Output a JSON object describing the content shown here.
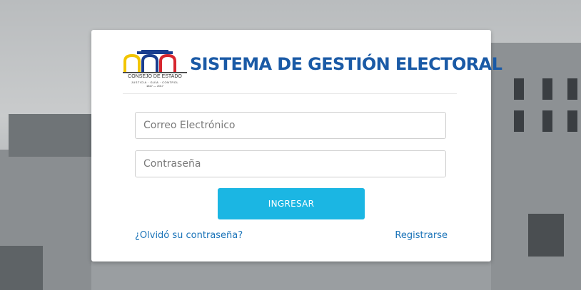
{
  "logo": {
    "name": "CONSEJO DE ESTADO",
    "motto": "JUSTICIA · GUÍA · CONTROL",
    "years": "1817 — 2017"
  },
  "title": "SISTEMA DE GESTIÓN ELECTORAL",
  "form": {
    "email_placeholder": "Correo Electrónico",
    "password_placeholder": "Contraseña",
    "submit_label": "INGRESAR",
    "forgot_label": "¿Olvidó su contraseña?",
    "register_label": "Registrarse"
  },
  "colors": {
    "brand": "#1a5aa6",
    "button": "#1bb6e3",
    "link": "#1a73b8"
  }
}
